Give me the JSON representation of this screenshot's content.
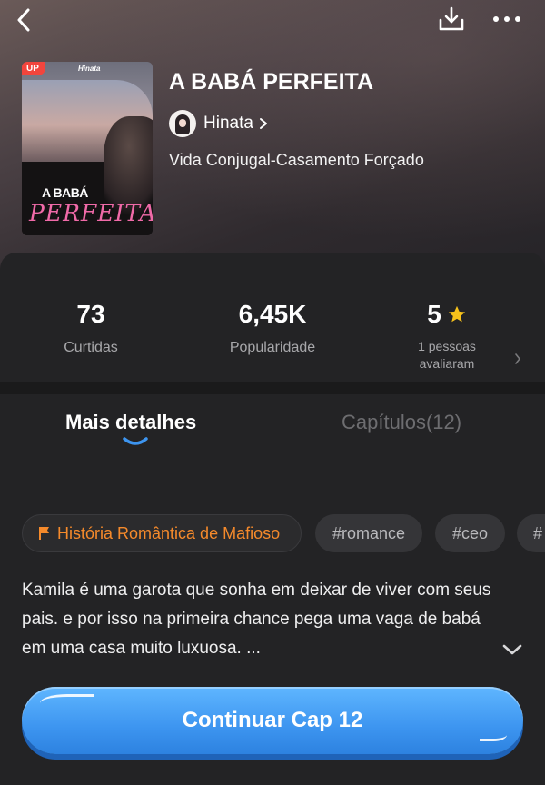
{
  "book": {
    "title": "A BABÁ PERFEITA",
    "author": "Hinata",
    "genre": "Vida Conjugal-Casamento Forçado",
    "cover": {
      "badge": "UP",
      "brand": "Hinata",
      "title_line1": "A BABÁ",
      "title_line2": "PERFEITA"
    }
  },
  "stats": {
    "likes_value": "73",
    "likes_label": "Curtidas",
    "popularity_value": "6,45K",
    "popularity_label": "Popularidade",
    "rating_value": "5",
    "rating_label_line1": "1 pessoas",
    "rating_label_line2": "avaliaram"
  },
  "tabs": {
    "details": "Mais detalhes",
    "chapters": "Capítulos(12)"
  },
  "tags": {
    "featured": "História Romântica de Mafioso",
    "items": [
      "#romance",
      "#ceo",
      "#"
    ]
  },
  "description": "Kamila é uma garota que sonha em deixar de viver com seus pais. e por isso na primeira chance pega uma vaga de babá em uma casa muito luxuosa.  ...",
  "cta": {
    "label": "Continuar Cap 12"
  },
  "colors": {
    "accent_blue": "#3d95f0",
    "tag_orange": "#f58a2b",
    "star_yellow": "#f7c21b",
    "badge_red": "#f2453d"
  },
  "icons": [
    "back-arrow-icon",
    "download-icon",
    "more-icon",
    "chevron-right-icon",
    "star-icon",
    "flag-icon",
    "chevron-down-icon"
  ]
}
